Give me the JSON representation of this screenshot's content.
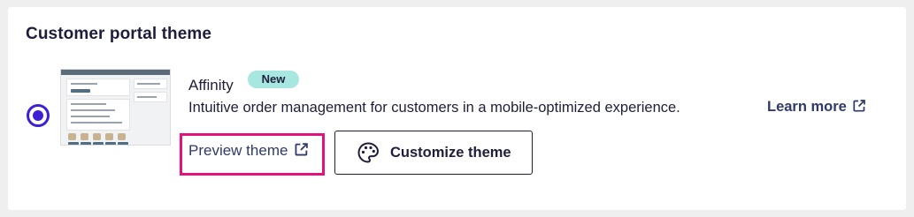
{
  "section": {
    "title": "Customer portal theme"
  },
  "theme": {
    "selected": true,
    "name": "Affinity",
    "badge": "New",
    "description": "Intuitive order management for customers in a mobile-optimized experience.",
    "learn_more_label": "Learn more",
    "preview_label": "Preview theme",
    "customize_label": "Customize theme"
  },
  "icons": {
    "learn_more": "external-link-icon",
    "preview": "external-link-icon",
    "customize": "palette-icon"
  },
  "colors": {
    "accent": "#3d1fd6",
    "badge_bg": "#a8e6e0",
    "highlight": "#e5127d",
    "link": "#2f3a6b",
    "text": "#1e1e3c"
  }
}
